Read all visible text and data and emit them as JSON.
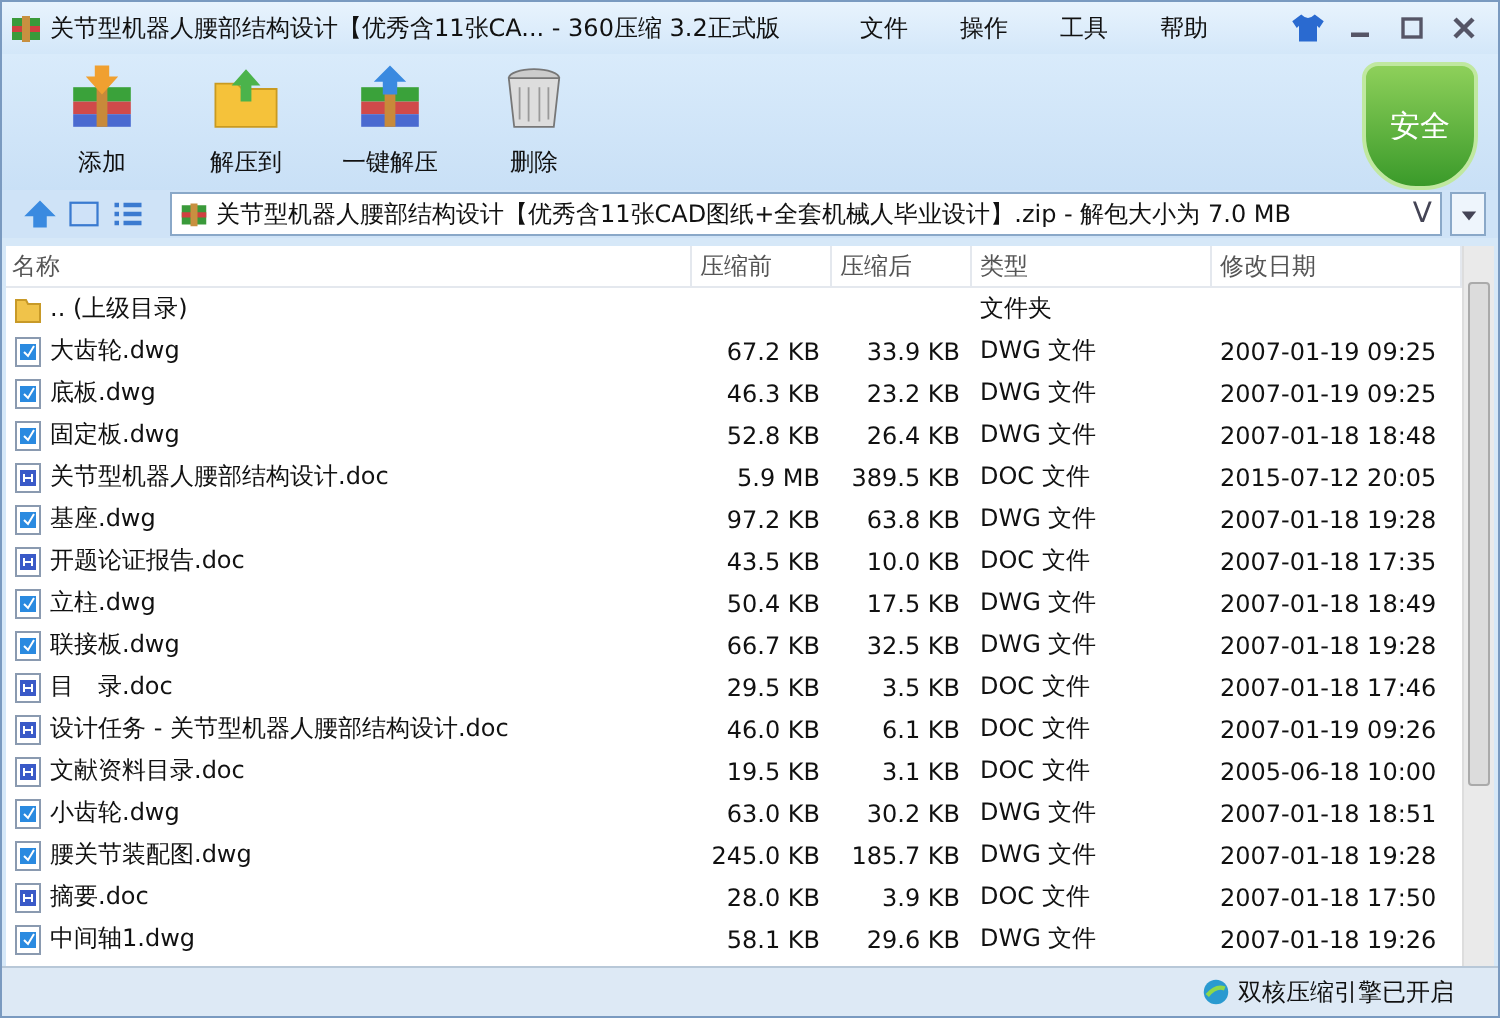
{
  "window": {
    "title": "关节型机器人腰部结构设计【优秀含11张CA... - 360压缩 3.2正式版"
  },
  "menu": [
    "文件",
    "操作",
    "工具",
    "帮助"
  ],
  "toolbar": {
    "buttons": [
      {
        "label": "添加",
        "kind": "add"
      },
      {
        "label": "解压到",
        "kind": "extract"
      },
      {
        "label": "一键解压",
        "kind": "oneclick"
      },
      {
        "label": "删除",
        "kind": "delete"
      }
    ],
    "badge": "安全"
  },
  "address": {
    "path": "关节型机器人腰部结构设计【优秀含11张CAD图纸+全套机械人毕业设计】.zip - 解包大小为 7.0 MB",
    "dropdown": "V"
  },
  "table": {
    "columns": [
      "名称",
      "压缩前",
      "压缩后",
      "类型",
      "修改日期"
    ],
    "rows": [
      {
        "kind": "folder",
        "name": ".. (上级目录)",
        "type": "文件夹"
      },
      {
        "kind": "dwg",
        "name": "大齿轮.dwg",
        "size": "67.2 KB",
        "packed": "33.9 KB",
        "type": "DWG 文件",
        "modified": "2007-01-19 09:25"
      },
      {
        "kind": "dwg",
        "name": "底板.dwg",
        "size": "46.3 KB",
        "packed": "23.2 KB",
        "type": "DWG 文件",
        "modified": "2007-01-19 09:25"
      },
      {
        "kind": "dwg",
        "name": "固定板.dwg",
        "size": "52.8 KB",
        "packed": "26.4 KB",
        "type": "DWG 文件",
        "modified": "2007-01-18 18:48"
      },
      {
        "kind": "doc",
        "name": "关节型机器人腰部结构设计.doc",
        "size": "5.9 MB",
        "packed": "389.5 KB",
        "type": "DOC 文件",
        "modified": "2015-07-12 20:05"
      },
      {
        "kind": "dwg",
        "name": "基座.dwg",
        "size": "97.2 KB",
        "packed": "63.8 KB",
        "type": "DWG 文件",
        "modified": "2007-01-18 19:28"
      },
      {
        "kind": "doc",
        "name": "开题论证报告.doc",
        "size": "43.5 KB",
        "packed": "10.0 KB",
        "type": "DOC 文件",
        "modified": "2007-01-18 17:35"
      },
      {
        "kind": "dwg",
        "name": "立柱.dwg",
        "size": "50.4 KB",
        "packed": "17.5 KB",
        "type": "DWG 文件",
        "modified": "2007-01-18 18:49"
      },
      {
        "kind": "dwg",
        "name": "联接板.dwg",
        "size": "66.7 KB",
        "packed": "32.5 KB",
        "type": "DWG 文件",
        "modified": "2007-01-18 19:28"
      },
      {
        "kind": "doc",
        "name": "目　录.doc",
        "size": "29.5 KB",
        "packed": "3.5 KB",
        "type": "DOC 文件",
        "modified": "2007-01-18 17:46"
      },
      {
        "kind": "doc",
        "name": "设计任务 - 关节型机器人腰部结构设计.doc",
        "size": "46.0 KB",
        "packed": "6.1 KB",
        "type": "DOC 文件",
        "modified": "2007-01-19 09:26"
      },
      {
        "kind": "doc",
        "name": "文献资料目录.doc",
        "size": "19.5 KB",
        "packed": "3.1 KB",
        "type": "DOC 文件",
        "modified": "2005-06-18 10:00"
      },
      {
        "kind": "dwg",
        "name": "小齿轮.dwg",
        "size": "63.0 KB",
        "packed": "30.2 KB",
        "type": "DWG 文件",
        "modified": "2007-01-18 18:51"
      },
      {
        "kind": "dwg",
        "name": "腰关节装配图.dwg",
        "size": "245.0 KB",
        "packed": "185.7 KB",
        "type": "DWG 文件",
        "modified": "2007-01-18 19:28"
      },
      {
        "kind": "doc",
        "name": "摘要.doc",
        "size": "28.0 KB",
        "packed": "3.9 KB",
        "type": "DOC 文件",
        "modified": "2007-01-18 17:50"
      },
      {
        "kind": "dwg",
        "name": "中间轴1.dwg",
        "size": "58.1 KB",
        "packed": "29.6 KB",
        "type": "DWG 文件",
        "modified": "2007-01-18 19:26"
      }
    ]
  },
  "status_bar": {
    "engine": "双核压缩引擎已开启"
  }
}
